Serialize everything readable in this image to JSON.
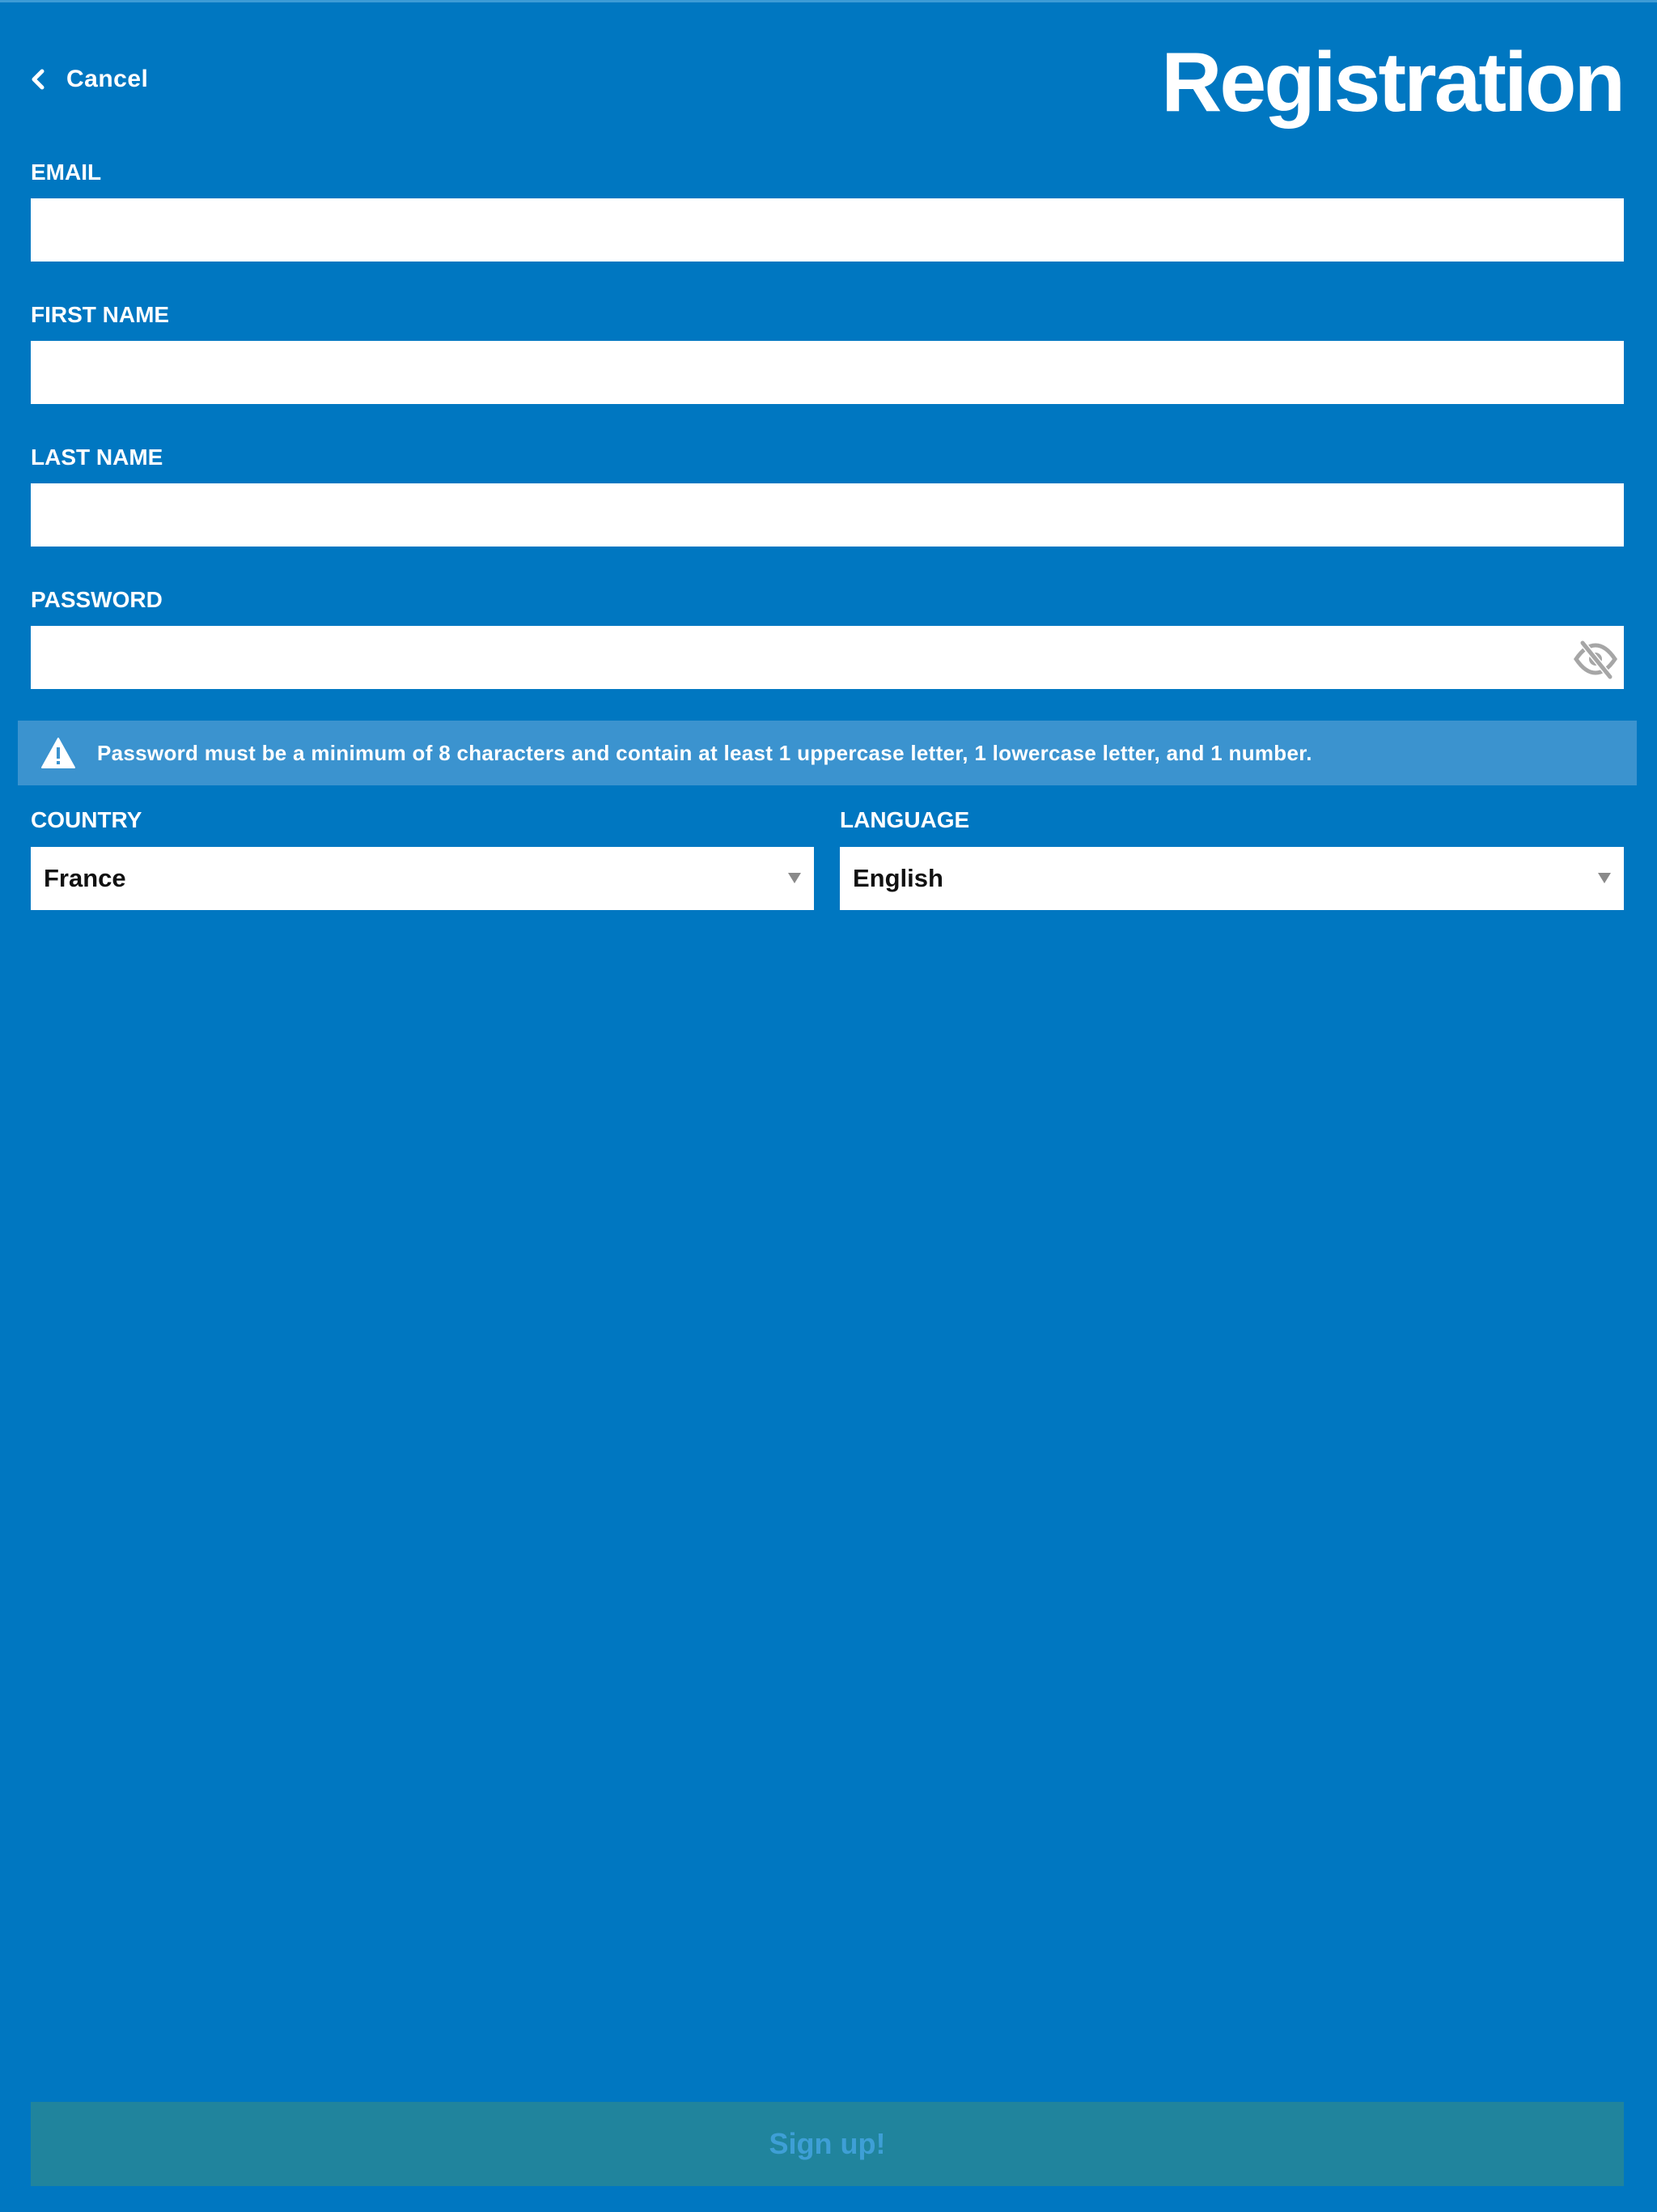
{
  "header": {
    "cancel_label": "Cancel",
    "title": "Registration"
  },
  "form": {
    "email": {
      "label": "EMAIL",
      "value": ""
    },
    "first_name": {
      "label": "FIRST NAME",
      "value": ""
    },
    "last_name": {
      "label": "LAST NAME",
      "value": ""
    },
    "password": {
      "label": "PASSWORD",
      "value": "",
      "toggle_icon": "eye-slash-icon"
    },
    "password_notice": {
      "icon": "warning-icon",
      "text": "Password must be a minimum of 8 characters and contain at least 1 uppercase letter, 1 lowercase letter, and 1 number."
    },
    "country": {
      "label": "COUNTRY",
      "selected": "France"
    },
    "language": {
      "label": "LANGUAGE",
      "selected": "English"
    }
  },
  "footer": {
    "signup_label": "Sign up!"
  },
  "colors": {
    "background": "#0077c1",
    "notice_background": "#3b93cf",
    "signup_background": "#20849d",
    "signup_text": "#3e9fd6"
  }
}
